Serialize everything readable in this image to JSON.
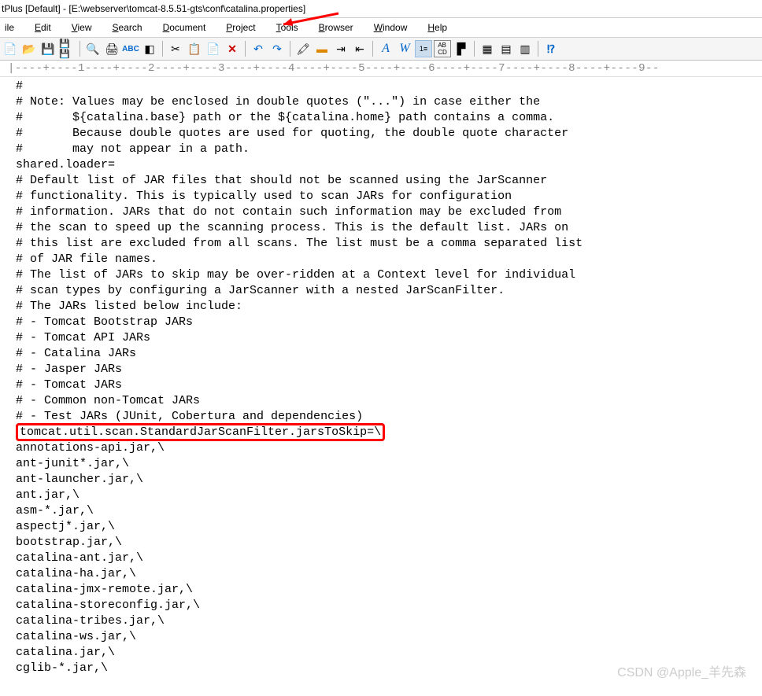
{
  "window": {
    "title": "tPlus [Default] - [E:\\webserver\\tomcat-8.5.51-gts\\conf\\catalina.properties]"
  },
  "menu": {
    "file": "ile",
    "edit": "Edit",
    "view": "View",
    "search": "Search",
    "document": "Document",
    "project": "Project",
    "tools": "Tools",
    "browser": "Browser",
    "window": "Window",
    "help": "Help"
  },
  "toolbar_icons": [
    "new",
    "open",
    "save",
    "saveall",
    "preview",
    "print",
    "spell",
    "toggle",
    "cut",
    "copy",
    "paste",
    "delete",
    "undo",
    "redo",
    "highlight",
    "fill",
    "indent",
    "outdent",
    "font-a",
    "word-wrap",
    "line-num",
    "ruler-grid",
    "marker",
    "panel1",
    "panel2",
    "panel3",
    "help"
  ],
  "ruler_text": "|----+----1----+----2----+----3----+----4----+----5----+----6----+----7----+----8----+----9--",
  "code_lines": [
    "#",
    "# Note: Values may be enclosed in double quotes (\"...\") in case either the",
    "#       ${catalina.base} path or the ${catalina.home} path contains a comma.",
    "#       Because double quotes are used for quoting, the double quote character",
    "#       may not appear in a path.",
    "shared.loader=",
    "",
    "# Default list of JAR files that should not be scanned using the JarScanner",
    "# functionality. This is typically used to scan JARs for configuration",
    "# information. JARs that do not contain such information may be excluded from",
    "# the scan to speed up the scanning process. This is the default list. JARs on",
    "# this list are excluded from all scans. The list must be a comma separated list",
    "# of JAR file names.",
    "# The list of JARs to skip may be over-ridden at a Context level for individual",
    "# scan types by configuring a JarScanner with a nested JarScanFilter.",
    "# The JARs listed below include:",
    "# - Tomcat Bootstrap JARs",
    "# - Tomcat API JARs",
    "# - Catalina JARs",
    "# - Jasper JARs",
    "# - Tomcat JARs",
    "# - Common non-Tomcat JARs",
    "# - Test JARs (JUnit, Cobertura and dependencies)",
    "tomcat.util.scan.StandardJarScanFilter.jarsToSkip=\\",
    "annotations-api.jar,\\",
    "ant-junit*.jar,\\",
    "ant-launcher.jar,\\",
    "ant.jar,\\",
    "asm-*.jar,\\",
    "aspectj*.jar,\\",
    "bootstrap.jar,\\",
    "catalina-ant.jar,\\",
    "catalina-ha.jar,\\",
    "catalina-jmx-remote.jar,\\",
    "catalina-storeconfig.jar,\\",
    "catalina-tribes.jar,\\",
    "catalina-ws.jar,\\",
    "catalina.jar,\\",
    "cglib-*.jar,\\"
  ],
  "highlight_index": 23,
  "watermark": "CSDN @Apple_羊先森"
}
